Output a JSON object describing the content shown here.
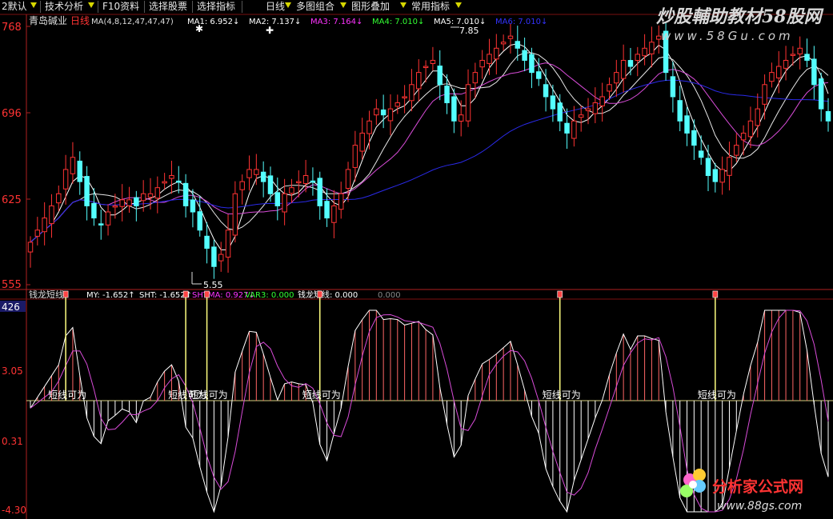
{
  "toolbar": {
    "items": [
      "2默认",
      "技术分析",
      "F10资料",
      "选择股票",
      "选择指标",
      "日线",
      "多图组合",
      "图形叠加",
      "常用指标"
    ]
  },
  "watermark": {
    "title": "炒股輔助教材58股网",
    "url": "www.58Gu.com",
    "bottom_title": "分析家公式网",
    "bottom_url": "www.88gs.com"
  },
  "price_panel": {
    "stock_name": "青岛碱业",
    "period": "日线",
    "ma_params": "MA(4,8,12,47,47,47)",
    "ma_readouts": [
      {
        "label": "MA1:",
        "value": "6.952↓",
        "color": "#ffffff"
      },
      {
        "label": "MA2:",
        "value": "7.137↓",
        "color": "#ffffff"
      },
      {
        "label": "MA3:",
        "value": "7.164↓",
        "color": "#ff33ff"
      },
      {
        "label": "MA4:",
        "value": "7.010↓",
        "color": "#33ff33"
      },
      {
        "label": "MA5:",
        "value": "7.010↓",
        "color": "#ffffff"
      },
      {
        "label": "MA6:",
        "value": "7.010↓",
        "color": "#3333ff"
      }
    ],
    "y_ticks": [
      "768",
      "696",
      "625",
      "555"
    ],
    "high_label": "7.85",
    "low_label": "5.55"
  },
  "indicator_panel": {
    "name": "钱龙短线",
    "readouts": [
      {
        "label": "MY:",
        "value": "-1.652↑",
        "color": "#ffffff"
      },
      {
        "label": "SHT:",
        "value": "-1.652↑",
        "color": "#ffffff"
      },
      {
        "label": "SHTMA:",
        "value": "0.927↓",
        "color": "#ff33ff"
      },
      {
        "label": "VAR3:",
        "value": "0.000",
        "color": "#33ff33"
      },
      {
        "label": "钱龙短线:",
        "value": "0.000",
        "color": "#ffffff"
      },
      {
        "label": "",
        "value": "0.000",
        "color": "#888888"
      }
    ],
    "y_ticks": [
      "426",
      "3.05",
      "0.31",
      "-4.30"
    ],
    "signal_text": "短线可为"
  },
  "colors": {
    "up": "#ff3333",
    "down": "#54ffff",
    "ma_white": "#ffffff",
    "ma_pink": "#d84cd8",
    "ma_blue": "#2a2ae8",
    "axis": "#b02020",
    "signal": "#ffff80"
  },
  "chart_data": {
    "type": "candlestick",
    "price_range": [
      5.55,
      7.68
    ],
    "indicator_range": [
      -4.3,
      4.26
    ],
    "closes": [
      5.9,
      6.0,
      6.1,
      6.2,
      6.3,
      6.5,
      6.6,
      6.4,
      6.2,
      6.1,
      6.05,
      6.15,
      6.2,
      6.25,
      6.25,
      6.2,
      6.3,
      6.3,
      6.35,
      6.4,
      6.45,
      6.4,
      6.2,
      6.15,
      6.0,
      5.85,
      5.7,
      5.8,
      6.0,
      6.3,
      6.4,
      6.5,
      6.5,
      6.4,
      6.3,
      6.2,
      6.3,
      6.35,
      6.4,
      6.45,
      6.4,
      6.2,
      6.1,
      6.2,
      6.3,
      6.5,
      6.7,
      6.8,
      6.9,
      7.0,
      6.95,
      7.0,
      7.05,
      7.1,
      7.2,
      7.3,
      7.35,
      7.4,
      7.2,
      7.05,
      6.9,
      6.95,
      7.2,
      7.3,
      7.4,
      7.45,
      7.5,
      7.55,
      7.6,
      7.5,
      7.4,
      7.3,
      7.25,
      7.1,
      7.0,
      6.9,
      6.8,
      6.9,
      6.95,
      7.0,
      7.05,
      7.1,
      7.2,
      7.3,
      7.4,
      7.35,
      7.45,
      7.5,
      7.55,
      7.6,
      7.3,
      7.1,
      6.9,
      6.8,
      6.7,
      6.6,
      6.45,
      6.4,
      6.5,
      6.6,
      6.7,
      6.8,
      6.9,
      7.0,
      7.2,
      7.3,
      7.35,
      7.4,
      7.45,
      7.5,
      7.4,
      7.2,
      7.0,
      6.9
    ],
    "signal_bars": [
      5,
      22,
      25,
      41,
      75,
      97
    ]
  }
}
